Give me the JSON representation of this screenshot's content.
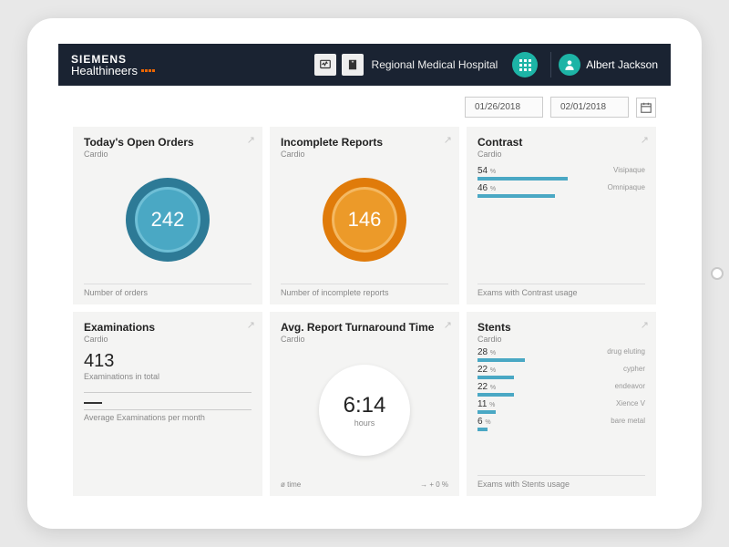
{
  "brand": {
    "top": "SIEMENS",
    "bottom": "Healthineers"
  },
  "hospital": "Regional Medical Hospital",
  "user": "Albert Jackson",
  "date_from": "01/26/2018",
  "date_to": "02/01/2018",
  "cards": {
    "open_orders": {
      "title": "Today's Open Orders",
      "sub": "Cardio",
      "value": "242",
      "foot": "Number of orders"
    },
    "incomplete": {
      "title": "Incomplete Reports",
      "sub": "Cardio",
      "value": "146",
      "foot": "Number of incomplete reports"
    },
    "contrast": {
      "title": "Contrast",
      "sub": "Cardio",
      "items": [
        {
          "pct": "54",
          "label": "Visipaque"
        },
        {
          "pct": "46",
          "label": "Omnipaque"
        }
      ],
      "foot": "Exams with Contrast usage"
    },
    "examinations": {
      "title": "Examinations",
      "sub": "Cardio",
      "value": "413",
      "label1": "Examinations in total",
      "label2": "Average Examinations per month"
    },
    "turnaround": {
      "title": "Avg. Report Turnaround Time",
      "sub": "Cardio",
      "value": "6:14",
      "unit": "hours",
      "left": "ø time",
      "right": "→ + 0 %"
    },
    "stents": {
      "title": "Stents",
      "sub": "Cardio",
      "items": [
        {
          "pct": "28",
          "label": "drug eluting"
        },
        {
          "pct": "22",
          "label": "cypher"
        },
        {
          "pct": "22",
          "label": "endeavor"
        },
        {
          "pct": "11",
          "label": "Xience V"
        },
        {
          "pct": "6",
          "label": "bare metal"
        }
      ],
      "foot": "Exams with Stents usage"
    }
  },
  "chart_data": [
    {
      "type": "bar",
      "title": "Contrast",
      "categories": [
        "Visipaque",
        "Omnipaque"
      ],
      "values": [
        54,
        46
      ],
      "xlabel": "",
      "ylabel": "%",
      "ylim": [
        0,
        100
      ]
    },
    {
      "type": "bar",
      "title": "Stents",
      "categories": [
        "drug eluting",
        "cypher",
        "endeavor",
        "Xience V",
        "bare metal"
      ],
      "values": [
        28,
        22,
        22,
        11,
        6
      ],
      "xlabel": "",
      "ylabel": "%",
      "ylim": [
        0,
        100
      ]
    }
  ],
  "colors": {
    "accent_teal": "#1db4a6",
    "donut_blue": "#4aa8c4",
    "donut_orange": "#ec9a29",
    "brand_orange": "#ec6602"
  }
}
